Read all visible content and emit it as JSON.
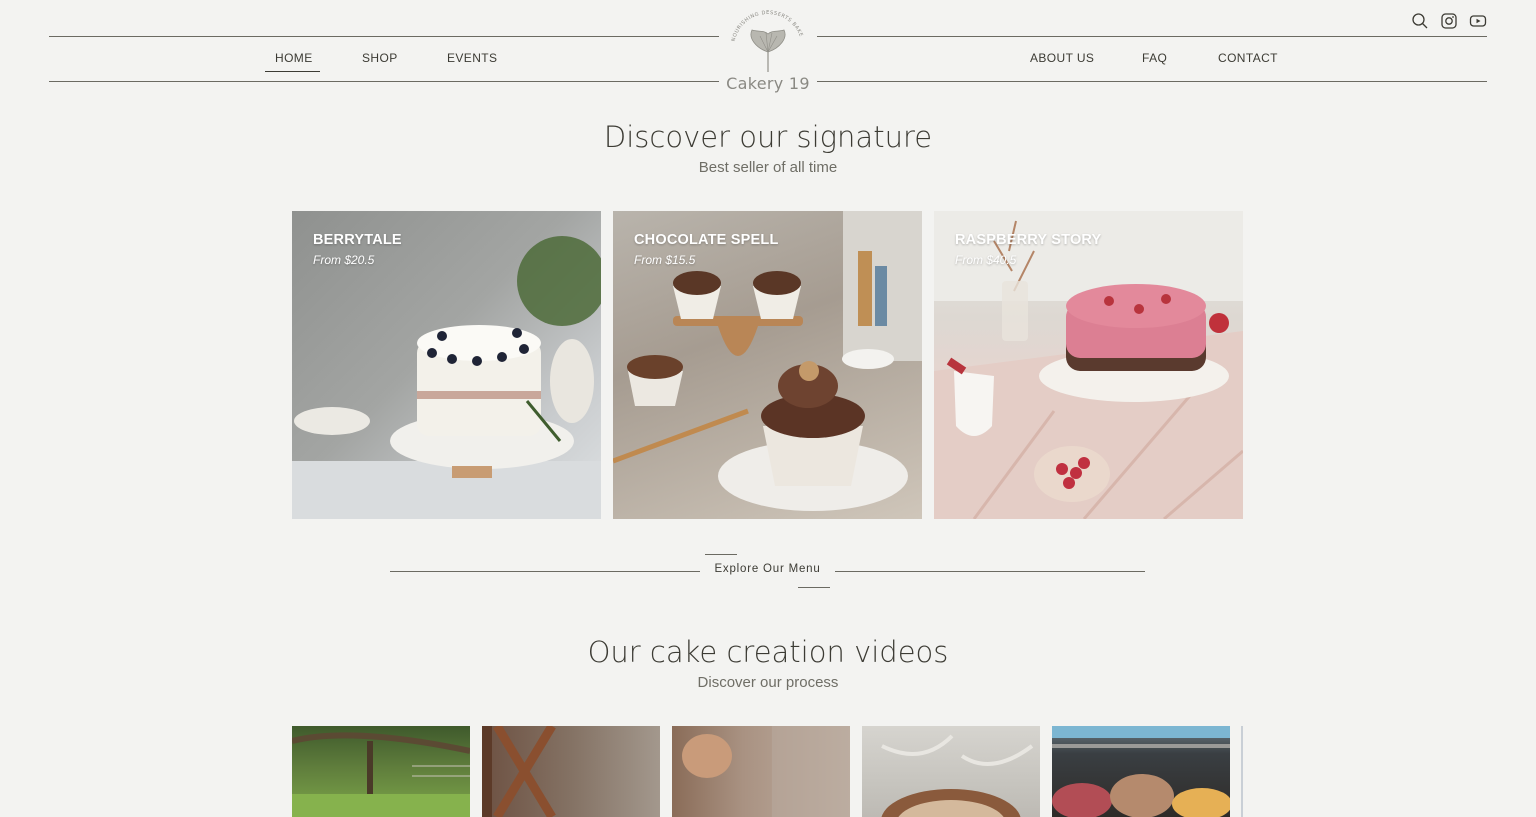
{
  "header": {
    "nav_left": [
      "HOME",
      "SHOP",
      "EVENTS"
    ],
    "nav_right": [
      "ABOUT US",
      "FAQ",
      "CONTACT"
    ],
    "logo": {
      "name": "Cakery 19",
      "arc_text": "NOURISHING DESSERTS BAKE"
    },
    "icons": [
      "search-icon",
      "instagram-icon",
      "youtube-icon"
    ]
  },
  "signature": {
    "title": "Discover our signature",
    "subtitle": "Best seller of all time",
    "products": [
      {
        "name": "BERRYTALE",
        "price": "From $20.5"
      },
      {
        "name": "CHOCOLATE SPELL",
        "price": "From $15.5"
      },
      {
        "name": "RASPBERRY STORY",
        "price": "From $40.5"
      }
    ]
  },
  "explore_button": "Explore Our Menu",
  "videos": {
    "title": "Our cake creation videos",
    "subtitle": "Discover our process"
  },
  "colors": {
    "background": "#f3f3f1",
    "text": "#3c3b34",
    "line": "#6b6a62"
  }
}
